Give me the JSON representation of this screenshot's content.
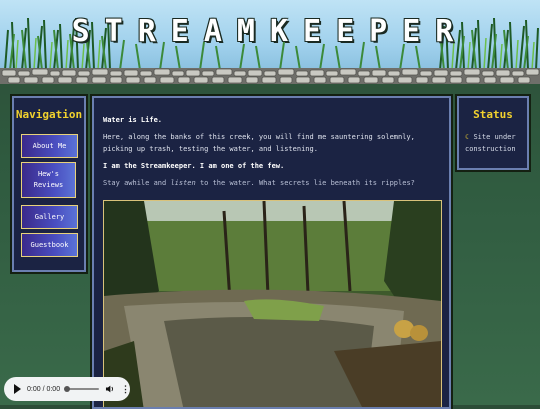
{
  "header": {
    "title": "STREAMKEEPER"
  },
  "navigation": {
    "title": "Navigation",
    "items": [
      {
        "label": "About Me"
      },
      {
        "label": "Hew's Reviews"
      },
      {
        "label": "Gallery"
      },
      {
        "label": "Guestbook"
      }
    ]
  },
  "status": {
    "title": "Status",
    "icon": "moon-icon",
    "text": "Site under construction"
  },
  "main": {
    "line1": "Water is Life.",
    "line2": "Here, along the banks of this creek, you will find me sauntering solemnly, picking up trash, testing the water, and listening.",
    "line3": "I am the Streamkeeper. I am one of the few.",
    "line4_before": "Stay awhile and ",
    "line4_em": "listen",
    "line4_after": " to the water. What secrets lie beneath its ripples?"
  },
  "audio": {
    "time": "0:00 / 0:00"
  },
  "colors": {
    "accent": "#f2d22e",
    "panel": "#1b2343",
    "border": "#6b7fb0"
  }
}
